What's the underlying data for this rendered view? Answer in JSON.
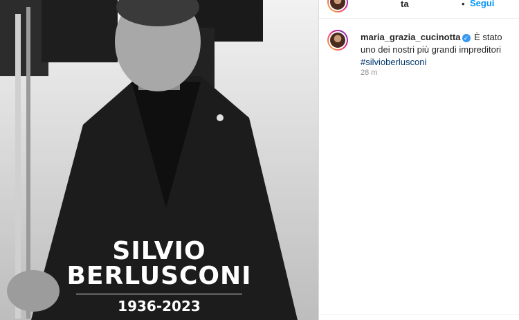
{
  "post": {
    "overlay": {
      "first_name": "SILVIO",
      "last_name": "BERLUSCONI",
      "years": "1936-2023"
    }
  },
  "header": {
    "username_fragment": "ta",
    "separator": "•",
    "follow_label": "Segui"
  },
  "caption": {
    "username": "maria_grazia_cucinotta",
    "verified_icon": "verified-badge-icon",
    "text": "È stato uno dei nostri più grandi impreditori",
    "hashtag": "#silvioberlusconi",
    "time": "28 m"
  },
  "colors": {
    "link": "#0095f6",
    "hashtag": "#00376b",
    "verified": "#3897f0"
  }
}
